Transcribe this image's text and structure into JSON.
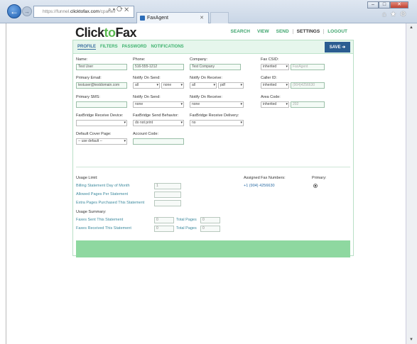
{
  "browser": {
    "address_prefix": "https://funnel.",
    "address_domain": "clicktofax.com",
    "address_suffix": "/cpanel/",
    "address_icons": "⌕ ▾ ⟳ ✕",
    "tab_title": "FaxAgent",
    "tab_close": "✕",
    "back_glyph": "←",
    "forward_glyph": "→",
    "window_buttons": [
      "–",
      "□",
      "✕"
    ],
    "tool_glyphs": "⌂★⚙"
  },
  "app": {
    "logo_part1": "Click",
    "logo_part2": "to",
    "logo_part3": "Fax",
    "topnav": [
      "SEARCH",
      "VIEW",
      "SEND",
      "SETTINGS",
      "LOGOUT"
    ],
    "topnav_active": "SETTINGS",
    "subnav": [
      "PROFILE",
      "FILTERS",
      "PASSWORD",
      "NOTIFICATIONS"
    ],
    "save_label": "SAVE ➔"
  },
  "form": {
    "name_label": "Name:",
    "name_value": "Test User",
    "phone_label": "Phone:",
    "phone_value": "516-555-1212",
    "company_label": "Company:",
    "company_value": "Test Company",
    "csid_label": "Fax CSID:",
    "csid_select": "inherited",
    "csid_placeholder": "FaxAgent",
    "email_label": "Primary Email:",
    "email_value": "testuser@testdomain.com",
    "notify_send_label": "Notify On Send:",
    "notify_send_a": "all",
    "notify_send_b": "none",
    "notify_recv_label": "Notify On Receive:",
    "notify_recv_a": "all",
    "notify_recv_b": "pdf",
    "callerid_label": "Caller ID:",
    "callerid_select": "inherited",
    "callerid_placeholder": "(904)4256630",
    "sms_label": "Primary SMS:",
    "notify_send2_label": "Notify On Send:",
    "notify_send2_value": "none",
    "notify_recv2_label": "Notify On Receive:",
    "notify_recv2_value": "none",
    "areacode_label": "Area Code:",
    "areacode_select": "inherited",
    "areacode_placeholder": "202",
    "fb_recv_device_label": "FaxBridge Receive Device:",
    "fb_send_behavior_label": "FaxBridge Send Behavior:",
    "fb_send_behavior_value": "do not print",
    "fb_recv_delivery_label": "FaxBridge Receive Delivery:",
    "fb_recv_delivery_value": "no",
    "cover_label": "Default Cover Page:",
    "cover_value": "-- use default --",
    "account_code_label": "Account Code:"
  },
  "usage": {
    "limit_heading": "Usage Limit:",
    "billing_day": "Billing Statement Day of Month",
    "billing_day_value": "1",
    "allowed_pages": "Allowed Pages Per Statement",
    "extra_pages": "Extra Pages Purchased This Statement",
    "summary_heading": "Usage Summary:",
    "faxes_sent": "Faxes Sent This Statement",
    "faxes_sent_value": "0",
    "faxes_recv": "Faxes Received This Statement",
    "faxes_recv_value": "0",
    "total_pages_label": "Total Pages",
    "total_pages_sent": "0",
    "total_pages_recv": "0",
    "assigned_heading": "Assigned Fax Numbers:",
    "assigned_number": "+1 (904) 4256630",
    "primary_heading": "Primary:"
  }
}
